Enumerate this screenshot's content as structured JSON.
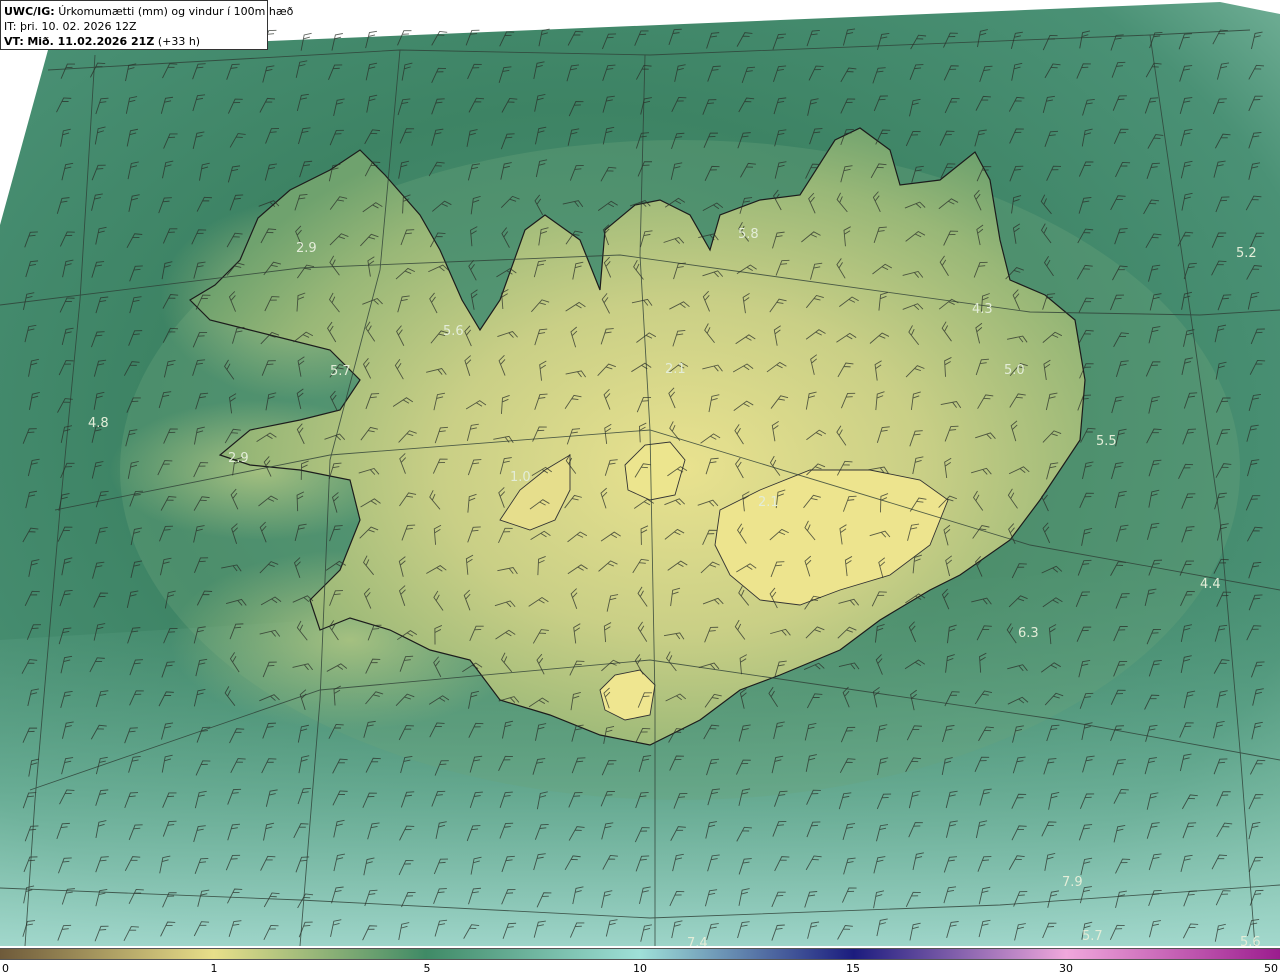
{
  "header": {
    "product_code": "UWC/IG:",
    "product_desc": "Úrkomumætti (mm) og vindur í 100m hæð",
    "init_prefix": "IT:",
    "init_time": "þri. 10. 02. 2026 12Z",
    "valid_prefix": "VT:",
    "valid_time": "Mið. 11.02.2026 21Z",
    "lead": "(+33 h)"
  },
  "map_labels": [
    {
      "text": "2.9"
    },
    {
      "text": "5.6"
    },
    {
      "text": "5.7"
    },
    {
      "text": "4.8"
    },
    {
      "text": "2.9"
    },
    {
      "text": "5.8"
    },
    {
      "text": "5.2"
    },
    {
      "text": "4.3"
    },
    {
      "text": "5.0"
    },
    {
      "text": "5.5"
    },
    {
      "text": "2.1"
    },
    {
      "text": "1.0"
    },
    {
      "text": "2.1"
    },
    {
      "text": "4.4"
    },
    {
      "text": "6.3"
    },
    {
      "text": "7.9"
    },
    {
      "text": "7.4"
    },
    {
      "text": "5.7"
    },
    {
      "text": "5.6"
    }
  ],
  "colorbar": {
    "ticks": [
      "0",
      "1",
      "5",
      "10",
      "15",
      "30",
      "50"
    ],
    "colors": {
      "brown": "#6e5a3a",
      "sand": "#e8df8a",
      "green": "#3f8a66",
      "teal": "#9fe0d8",
      "navy": "#1b1c7e",
      "pink": "#f0a8dc",
      "magenta": "#9b1c8e"
    }
  },
  "icons": {
    "wind_barb": "wind-barb-icon"
  }
}
